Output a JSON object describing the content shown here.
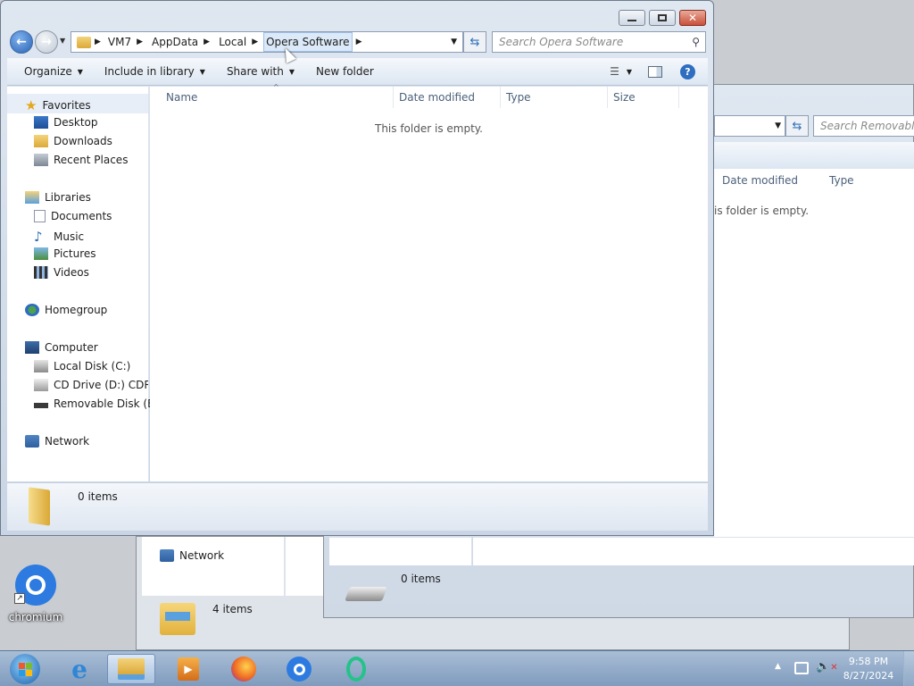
{
  "desktop": {
    "icon_label": "chromium"
  },
  "bg_window_right": {
    "search_placeholder": "Search Removable D",
    "col_date": "Date modified",
    "col_type": "Type",
    "empty_text": "is folder is empty.",
    "status": "0 items"
  },
  "bg_window_back": {
    "nav_network": "Network",
    "status": "4 items"
  },
  "window": {
    "breadcrumbs": [
      "VM7",
      "AppData",
      "Local",
      "Opera Software"
    ],
    "search_placeholder": "Search Opera Software",
    "toolbar": {
      "organize": "Organize",
      "include_in_library": "Include in library",
      "share_with": "Share with",
      "new_folder": "New folder"
    },
    "nav": {
      "favorites": "Favorites",
      "desktop": "Desktop",
      "downloads": "Downloads",
      "recent_places": "Recent Places",
      "libraries": "Libraries",
      "documents": "Documents",
      "music": "Music",
      "pictures": "Pictures",
      "videos": "Videos",
      "homegroup": "Homegroup",
      "computer": "Computer",
      "local_disk": "Local Disk (C:)",
      "cd_drive": "CD Drive (D:) CDROM",
      "removable_disk": "Removable Disk (E:)",
      "network": "Network"
    },
    "columns": {
      "name": "Name",
      "date_modified": "Date modified",
      "type": "Type",
      "size": "Size"
    },
    "empty_text": "This folder is empty.",
    "status": "0 items"
  },
  "taskbar": {
    "time": "9:58 PM",
    "date": "8/27/2024"
  },
  "colors": {
    "accent": "#3c7fc6",
    "taskbar": "#8ea8c6"
  }
}
